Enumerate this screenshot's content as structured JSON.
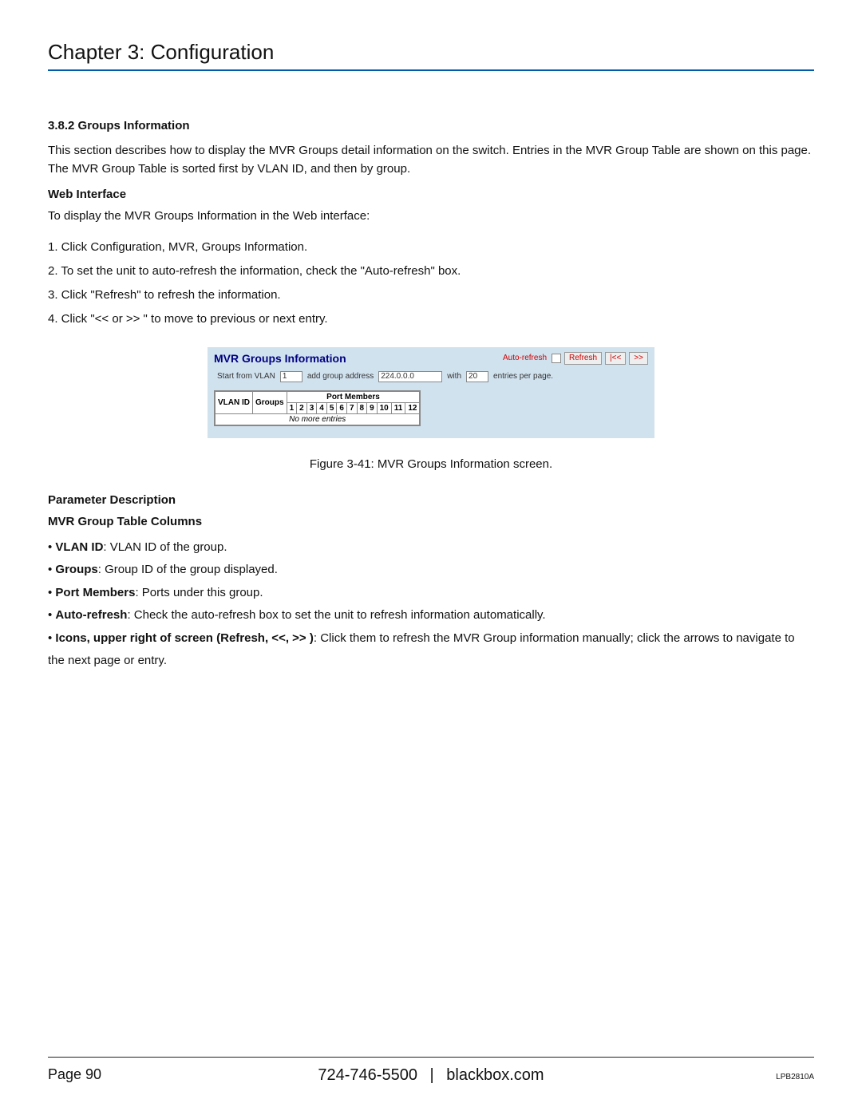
{
  "chapter_title": "Chapter 3: Configuration",
  "section": {
    "number_title": "3.8.2 Groups Information",
    "intro": "This section describes how to display the MVR Groups detail information on the switch. Entries in the MVR Group Table are shown on this page. The MVR Group Table is sorted first by VLAN ID, and then by group.",
    "web_interface_heading": "Web Interface",
    "web_interface_lead": "To display the MVR Groups Information in the Web interface:",
    "steps": [
      "1. Click Configuration, MVR, Groups Information.",
      "2. To set the unit to auto-refresh the information, check the \"Auto-refresh\" box.",
      "3. Click \"Refresh\" to refresh the information.",
      "4. Click \"<< or >> \" to move to previous or next entry."
    ]
  },
  "figure": {
    "title": "MVR Groups Information",
    "auto_refresh_label": "Auto-refresh",
    "buttons": {
      "refresh": "Refresh",
      "prev": "|<<",
      "next": ">>"
    },
    "filter": {
      "start_label": "Start from VLAN",
      "start_value": "1",
      "addr_label": "add group address",
      "addr_value": "224.0.0.0",
      "with_label": "with",
      "with_value": "20",
      "per_page_label": "entries per page."
    },
    "table": {
      "vlan_header": "VLAN ID",
      "groups_header": "Groups",
      "port_members_header": "Port Members",
      "ports": [
        "1",
        "2",
        "3",
        "4",
        "5",
        "6",
        "7",
        "8",
        "9",
        "10",
        "11",
        "12"
      ],
      "no_entries": "No more entries"
    },
    "caption": "Figure 3-41: MVR Groups Information screen."
  },
  "params": {
    "heading": "Parameter Description",
    "subheading": "MVR Group Table Columns",
    "items": [
      {
        "label": "VLAN ID",
        "text": ": VLAN ID of the group."
      },
      {
        "label": "Groups",
        "text": ": Group ID of the group displayed."
      },
      {
        "label": "Port Members",
        "text": ": Ports under this group."
      },
      {
        "label": "Auto-refresh",
        "text": ": Check the auto-refresh box to set the unit to refresh information automatically."
      },
      {
        "label": "Icons, upper right of screen (Refresh, <<, >> )",
        "text": ": Click them to refresh the MVR Group information manually; click the arrows to navigate to the next page or entry."
      }
    ]
  },
  "footer": {
    "page_label": "Page 90",
    "phone": "724-746-5500",
    "site": "blackbox.com",
    "model": "LPB2810A",
    "separator": "|"
  }
}
